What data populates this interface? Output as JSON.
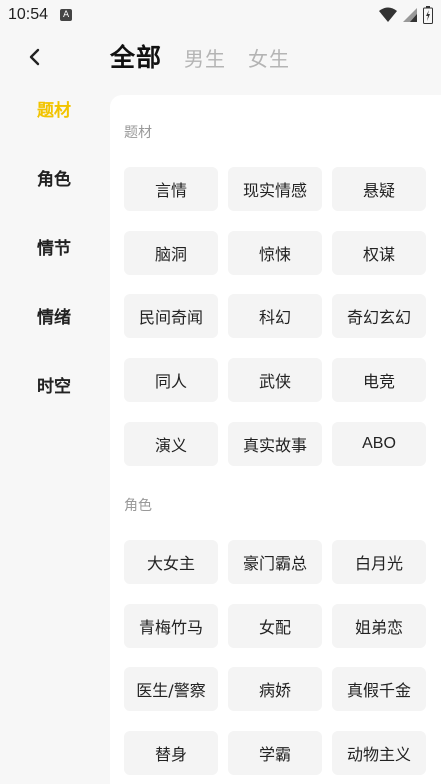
{
  "status": {
    "time": "10:54",
    "notif_glyph": "A"
  },
  "header": {
    "tabs": [
      {
        "label": "全部",
        "active": true
      },
      {
        "label": "男生",
        "active": false
      },
      {
        "label": "女生",
        "active": false
      }
    ]
  },
  "sidebar": {
    "items": [
      {
        "label": "题材",
        "active": true
      },
      {
        "label": "角色",
        "active": false
      },
      {
        "label": "情节",
        "active": false
      },
      {
        "label": "情绪",
        "active": false
      },
      {
        "label": "时空",
        "active": false
      }
    ]
  },
  "sections": [
    {
      "title": "题材",
      "tags": [
        "言情",
        "现实情感",
        "悬疑",
        "脑洞",
        "惊悚",
        "权谋",
        "民间奇闻",
        "科幻",
        "奇幻玄幻",
        "同人",
        "武侠",
        "电竞",
        "演义",
        "真实故事",
        "ABO"
      ]
    },
    {
      "title": "角色",
      "tags": [
        "大女主",
        "豪门霸总",
        "白月光",
        "青梅竹马",
        "女配",
        "姐弟恋",
        "医生/警察",
        "病娇",
        "真假千金",
        "替身",
        "学霸",
        "动物主义"
      ]
    }
  ],
  "colors": {
    "accent": "#f2c400",
    "tag_bg": "#f4f4f4",
    "panel_bg": "#ffffff",
    "page_bg": "#f7f7f7"
  }
}
